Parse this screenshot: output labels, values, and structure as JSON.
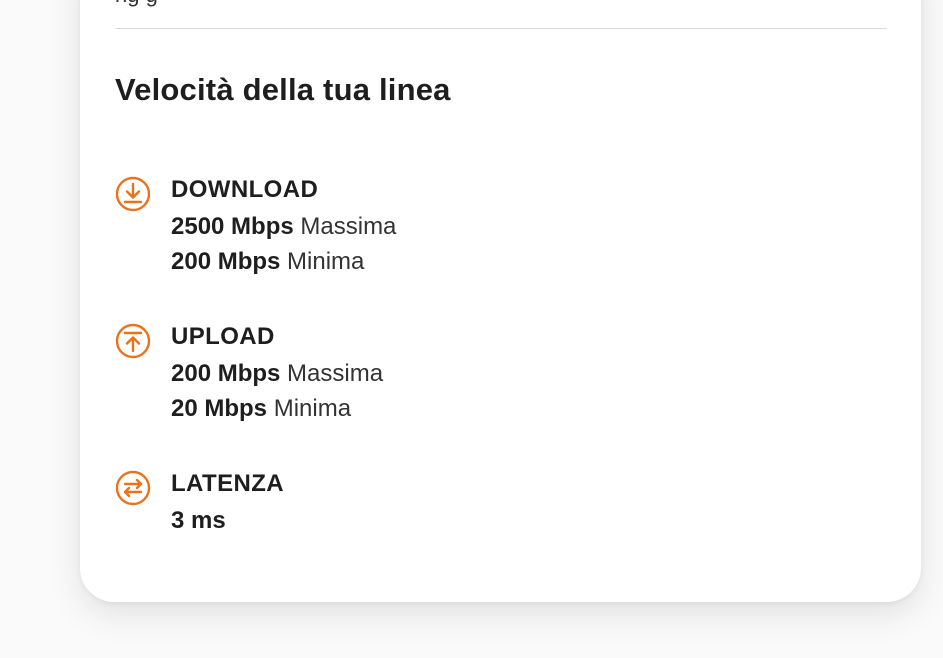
{
  "page": {
    "top_clipped_text": "ng                           g",
    "section_title": "Velocità della tua linea"
  },
  "colors": {
    "accent": "#e8731b",
    "text": "#1e1e1e",
    "divider": "#dcdcdc"
  },
  "metrics": {
    "download": {
      "icon": "download-circle-icon",
      "label": "DOWNLOAD",
      "max_value": "2500 Mbps",
      "max_label": "Massima",
      "min_value": "200 Mbps",
      "min_label": "Minima"
    },
    "upload": {
      "icon": "upload-circle-icon",
      "label": "UPLOAD",
      "max_value": "200 Mbps",
      "max_label": "Massima",
      "min_value": "20 Mbps",
      "min_label": "Minima"
    },
    "latency": {
      "icon": "swap-arrows-icon",
      "label": "LATENZA",
      "value": "3 ms"
    }
  }
}
